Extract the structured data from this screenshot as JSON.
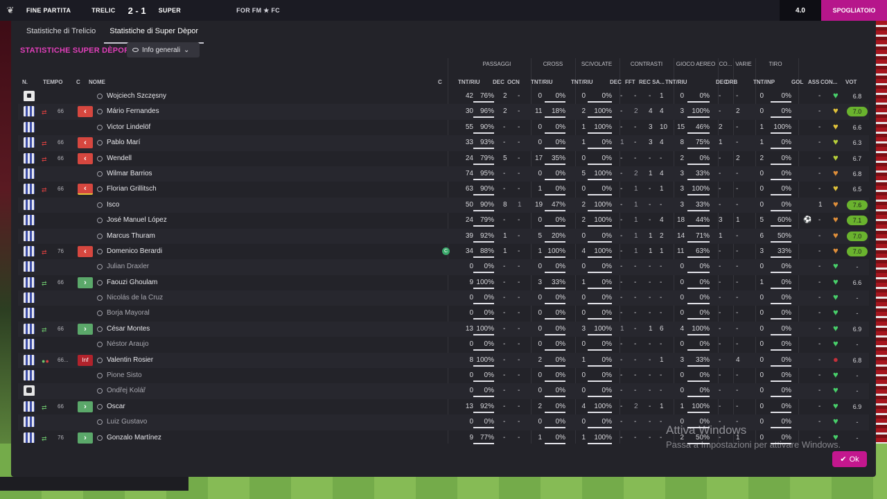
{
  "topbar": {
    "status": "FINE PARTITA",
    "home": "TRELIC",
    "score": "2 - 1",
    "away": "SUPER",
    "sponsor": "FOR FM ★ FC",
    "counter": "4.0",
    "action": "SPOGLIATOIO"
  },
  "tabs": [
    "Statistiche di Trelicio",
    "Statistiche di Super Dèpor"
  ],
  "section_title": "STATISTICHE SUPER DÈPOR",
  "view_dropdown": "Info generali",
  "groups": [
    "PASSAGGI",
    "CROSS",
    "SCIVOLATE",
    "CONTRASTI",
    "GIOCO AEREO",
    "CO...",
    "VARIE",
    "TIRO"
  ],
  "columns": [
    "N.",
    "TEMPO",
    "C",
    "NOME",
    "C",
    "TNT/RIU",
    "DEC",
    "OCN",
    "TNT/RIU",
    "TNT/RIU",
    "DEC",
    "FFT",
    "REC SA...",
    "TNT/RIU",
    "DEC",
    "DRB",
    "TNT/INP",
    "GOL",
    "ASS",
    "CON...",
    "VOT"
  ],
  "rows": [
    {
      "name": "Wojciech Szczęsny",
      "kit": "gk",
      "sub": "",
      "min": "",
      "badge": "",
      "pm": "42",
      "pp": "76%",
      "dec": "2",
      "ocn": "-",
      "cr": "0",
      "crp": "0%",
      "sc": "0",
      "scp": "0%",
      "cdec": "-",
      "fft": "-",
      "rec": "-",
      "sa": "1",
      "ga": "0",
      "gap": "0%",
      "codec": "-",
      "drb": "-",
      "ti": "0",
      "tip": "0%",
      "gol": "",
      "ass": "-",
      "con": "green",
      "vot": "6.8",
      "votHL": false
    },
    {
      "name": "Mário Fernandes",
      "kit": "field",
      "sub": "red",
      "min": "66",
      "badge": "out",
      "pm": "30",
      "pp": "96%",
      "dec": "2",
      "ocn": "-",
      "cr": "11",
      "crp": "18%",
      "sc": "2",
      "scp": "100%",
      "cdec": "-",
      "fft": "2",
      "rec": "4",
      "sa": "4",
      "ga": "3",
      "gap": "100%",
      "codec": "-",
      "drb": "2",
      "ti": "0",
      "tip": "0%",
      "gol": "",
      "ass": "-",
      "con": "yellow",
      "vot": "7.0",
      "votHL": true
    },
    {
      "name": "Victor Lindelöf",
      "kit": "field",
      "sub": "",
      "min": "",
      "badge": "",
      "pm": "55",
      "pp": "90%",
      "dec": "-",
      "ocn": "-",
      "cr": "0",
      "crp": "0%",
      "sc": "1",
      "scp": "100%",
      "cdec": "-",
      "fft": "-",
      "rec": "3",
      "sa": "10",
      "ga": "15",
      "gap": "46%",
      "codec": "2",
      "drb": "-",
      "ti": "1",
      "tip": "100%",
      "gol": "",
      "ass": "-",
      "con": "yellow",
      "vot": "6.6",
      "votHL": false
    },
    {
      "name": "Pablo Marí",
      "kit": "field",
      "sub": "red",
      "min": "66",
      "badge": "out",
      "pm": "33",
      "pp": "93%",
      "dec": "-",
      "ocn": "-",
      "cr": "0",
      "crp": "0%",
      "sc": "1",
      "scp": "0%",
      "cdec": "1",
      "fft": "-",
      "rec": "3",
      "sa": "4",
      "ga": "8",
      "gap": "75%",
      "codec": "1",
      "drb": "-",
      "ti": "1",
      "tip": "0%",
      "gol": "",
      "ass": "-",
      "con": "yellowgreen",
      "vot": "6.3",
      "votHL": false
    },
    {
      "name": "Wendell",
      "kit": "field",
      "sub": "red",
      "min": "66",
      "badge": "out",
      "pm": "24",
      "pp": "79%",
      "dec": "5",
      "ocn": "-",
      "cr": "17",
      "crp": "35%",
      "sc": "0",
      "scp": "0%",
      "cdec": "-",
      "fft": "-",
      "rec": "-",
      "sa": "-",
      "ga": "2",
      "gap": "0%",
      "codec": "-",
      "drb": "2",
      "ti": "2",
      "tip": "0%",
      "gol": "",
      "ass": "-",
      "con": "yellowgreen",
      "vot": "6.7",
      "votHL": false
    },
    {
      "name": "Wilmar Barrios",
      "kit": "field",
      "sub": "",
      "min": "",
      "badge": "",
      "pm": "74",
      "pp": "95%",
      "dec": "-",
      "ocn": "-",
      "cr": "0",
      "crp": "0%",
      "sc": "5",
      "scp": "100%",
      "cdec": "-",
      "fft": "2",
      "rec": "1",
      "sa": "4",
      "ga": "3",
      "gap": "33%",
      "codec": "-",
      "drb": "-",
      "ti": "0",
      "tip": "0%",
      "gol": "",
      "ass": "-",
      "con": "orange",
      "vot": "6.8",
      "votHL": false
    },
    {
      "name": "Florian Grillitsch",
      "kit": "field",
      "sub": "red",
      "min": "66",
      "badge": "out yl",
      "pm": "63",
      "pp": "90%",
      "dec": "-",
      "ocn": "-",
      "cr": "1",
      "crp": "0%",
      "sc": "0",
      "scp": "0%",
      "cdec": "-",
      "fft": "1",
      "rec": "-",
      "sa": "1",
      "ga": "3",
      "gap": "100%",
      "codec": "-",
      "drb": "-",
      "ti": "0",
      "tip": "0%",
      "gol": "",
      "ass": "-",
      "con": "yellow",
      "vot": "6.5",
      "votHL": false
    },
    {
      "name": "Isco",
      "kit": "field",
      "sub": "",
      "min": "",
      "badge": "",
      "pm": "50",
      "pp": "90%",
      "dec": "8",
      "ocn": "1",
      "cr": "19",
      "crp": "47%",
      "sc": "2",
      "scp": "100%",
      "cdec": "-",
      "fft": "1",
      "rec": "-",
      "sa": "-",
      "ga": "3",
      "gap": "33%",
      "codec": "-",
      "drb": "-",
      "ti": "0",
      "tip": "0%",
      "gol": "",
      "ass": "1",
      "con": "orange",
      "vot": "7.6",
      "votHL": true
    },
    {
      "name": "José Manuel López",
      "kit": "field",
      "sub": "",
      "min": "",
      "badge": "",
      "pm": "24",
      "pp": "79%",
      "dec": "-",
      "ocn": "-",
      "cr": "0",
      "crp": "0%",
      "sc": "2",
      "scp": "100%",
      "cdec": "-",
      "fft": "1",
      "rec": "-",
      "sa": "4",
      "ga": "18",
      "gap": "44%",
      "codec": "3",
      "drb": "1",
      "ti": "5",
      "tip": "60%",
      "gol": "⚽",
      "ass": "-",
      "con": "orange",
      "vot": "7.1",
      "votHL": true
    },
    {
      "name": "Marcus Thuram",
      "kit": "field",
      "sub": "",
      "min": "",
      "badge": "",
      "pm": "39",
      "pp": "92%",
      "dec": "1",
      "ocn": "-",
      "cr": "5",
      "crp": "20%",
      "sc": "0",
      "scp": "0%",
      "cdec": "-",
      "fft": "1",
      "rec": "1",
      "sa": "2",
      "ga": "14",
      "gap": "71%",
      "codec": "1",
      "drb": "-",
      "ti": "6",
      "tip": "50%",
      "gol": "",
      "ass": "-",
      "con": "orange",
      "vot": "7.0",
      "votHL": true
    },
    {
      "name": "Domenico Berardi",
      "kit": "field",
      "sub": "red",
      "min": "76",
      "badge": "out",
      "pm": "34",
      "pp": "88%",
      "dec": "1",
      "ocn": "-",
      "cr": "1",
      "crp": "100%",
      "sc": "4",
      "scp": "100%",
      "cdec": "-",
      "fft": "1",
      "rec": "1",
      "sa": "1",
      "ga": "11",
      "gap": "63%",
      "codec": "-",
      "drb": "-",
      "ti": "3",
      "tip": "33%",
      "gol": "",
      "ass": "-",
      "con": "orange",
      "vot": "7.0",
      "votHL": true,
      "cap": "C"
    },
    {
      "name": "Julian Draxler",
      "kit": "field",
      "sub": "",
      "min": "",
      "badge": "",
      "pm": "0",
      "pp": "0%",
      "dec": "-",
      "ocn": "-",
      "cr": "0",
      "crp": "0%",
      "sc": "0",
      "scp": "0%",
      "cdec": "-",
      "fft": "-",
      "rec": "-",
      "sa": "-",
      "ga": "0",
      "gap": "0%",
      "codec": "-",
      "drb": "-",
      "ti": "0",
      "tip": "0%",
      "gol": "",
      "ass": "-",
      "con": "green",
      "vot": "-",
      "votHL": false,
      "dim": true
    },
    {
      "name": "Faouzi Ghoulam",
      "kit": "field",
      "sub": "grn",
      "min": "66",
      "badge": "in",
      "pm": "9",
      "pp": "100%",
      "dec": "-",
      "ocn": "-",
      "cr": "3",
      "crp": "33%",
      "sc": "1",
      "scp": "0%",
      "cdec": "-",
      "fft": "-",
      "rec": "-",
      "sa": "-",
      "ga": "0",
      "gap": "0%",
      "codec": "-",
      "drb": "-",
      "ti": "1",
      "tip": "0%",
      "gol": "",
      "ass": "-",
      "con": "green",
      "vot": "6.6",
      "votHL": false
    },
    {
      "name": "Nicolás de la Cruz",
      "kit": "field",
      "sub": "",
      "min": "",
      "badge": "",
      "pm": "0",
      "pp": "0%",
      "dec": "-",
      "ocn": "-",
      "cr": "0",
      "crp": "0%",
      "sc": "0",
      "scp": "0%",
      "cdec": "-",
      "fft": "-",
      "rec": "-",
      "sa": "-",
      "ga": "0",
      "gap": "0%",
      "codec": "-",
      "drb": "-",
      "ti": "0",
      "tip": "0%",
      "gol": "",
      "ass": "-",
      "con": "green",
      "vot": "-",
      "votHL": false,
      "dim": true
    },
    {
      "name": "Borja Mayoral",
      "kit": "field",
      "sub": "",
      "min": "",
      "badge": "",
      "pm": "0",
      "pp": "0%",
      "dec": "-",
      "ocn": "-",
      "cr": "0",
      "crp": "0%",
      "sc": "0",
      "scp": "0%",
      "cdec": "-",
      "fft": "-",
      "rec": "-",
      "sa": "-",
      "ga": "0",
      "gap": "0%",
      "codec": "-",
      "drb": "-",
      "ti": "0",
      "tip": "0%",
      "gol": "",
      "ass": "-",
      "con": "green",
      "vot": "-",
      "votHL": false,
      "dim": true
    },
    {
      "name": "César Montes",
      "kit": "field",
      "sub": "grn",
      "min": "66",
      "badge": "in",
      "pm": "13",
      "pp": "100%",
      "dec": "-",
      "ocn": "-",
      "cr": "0",
      "crp": "0%",
      "sc": "3",
      "scp": "100%",
      "cdec": "1",
      "fft": "-",
      "rec": "1",
      "sa": "6",
      "ga": "4",
      "gap": "100%",
      "codec": "-",
      "drb": "-",
      "ti": "0",
      "tip": "0%",
      "gol": "",
      "ass": "-",
      "con": "green",
      "vot": "6.9",
      "votHL": false
    },
    {
      "name": "Néstor Araujo",
      "kit": "field",
      "sub": "",
      "min": "",
      "badge": "",
      "pm": "0",
      "pp": "0%",
      "dec": "-",
      "ocn": "-",
      "cr": "0",
      "crp": "0%",
      "sc": "0",
      "scp": "0%",
      "cdec": "-",
      "fft": "-",
      "rec": "-",
      "sa": "-",
      "ga": "0",
      "gap": "0%",
      "codec": "-",
      "drb": "-",
      "ti": "0",
      "tip": "0%",
      "gol": "",
      "ass": "-",
      "con": "green",
      "vot": "-",
      "votHL": false,
      "dim": true
    },
    {
      "name": "Valentin Rosier",
      "kit": "field",
      "sub": "mix",
      "min": "66...",
      "badge": "inf",
      "pm": "8",
      "pp": "100%",
      "dec": "-",
      "ocn": "-",
      "cr": "2",
      "crp": "0%",
      "sc": "1",
      "scp": "0%",
      "cdec": "-",
      "fft": "-",
      "rec": "-",
      "sa": "1",
      "ga": "3",
      "gap": "33%",
      "codec": "-",
      "drb": "4",
      "ti": "0",
      "tip": "0%",
      "gol": "",
      "ass": "-",
      "con": "red",
      "vot": "6.8",
      "votHL": false
    },
    {
      "name": "Pione Sisto",
      "kit": "field",
      "sub": "",
      "min": "",
      "badge": "",
      "pm": "0",
      "pp": "0%",
      "dec": "-",
      "ocn": "-",
      "cr": "0",
      "crp": "0%",
      "sc": "0",
      "scp": "0%",
      "cdec": "-",
      "fft": "-",
      "rec": "-",
      "sa": "-",
      "ga": "0",
      "gap": "0%",
      "codec": "-",
      "drb": "-",
      "ti": "0",
      "tip": "0%",
      "gol": "",
      "ass": "-",
      "con": "green",
      "vot": "-",
      "votHL": false,
      "dim": true
    },
    {
      "name": "Ondřej Kolář",
      "kit": "gkd",
      "sub": "",
      "min": "",
      "badge": "",
      "pm": "0",
      "pp": "0%",
      "dec": "-",
      "ocn": "-",
      "cr": "0",
      "crp": "0%",
      "sc": "0",
      "scp": "0%",
      "cdec": "-",
      "fft": "-",
      "rec": "-",
      "sa": "-",
      "ga": "0",
      "gap": "0%",
      "codec": "-",
      "drb": "-",
      "ti": "0",
      "tip": "0%",
      "gol": "",
      "ass": "-",
      "con": "green",
      "vot": "-",
      "votHL": false,
      "dim": true
    },
    {
      "name": "Oscar",
      "kit": "field",
      "sub": "grn",
      "min": "66",
      "badge": "in",
      "pm": "13",
      "pp": "92%",
      "dec": "-",
      "ocn": "-",
      "cr": "2",
      "crp": "0%",
      "sc": "4",
      "scp": "100%",
      "cdec": "-",
      "fft": "2",
      "rec": "-",
      "sa": "1",
      "ga": "1",
      "gap": "100%",
      "codec": "-",
      "drb": "-",
      "ti": "0",
      "tip": "0%",
      "gol": "",
      "ass": "-",
      "con": "green",
      "vot": "6.9",
      "votHL": false
    },
    {
      "name": "Luiz Gustavo",
      "kit": "field",
      "sub": "",
      "min": "",
      "badge": "",
      "pm": "0",
      "pp": "0%",
      "dec": "-",
      "ocn": "-",
      "cr": "0",
      "crp": "0%",
      "sc": "0",
      "scp": "0%",
      "cdec": "-",
      "fft": "-",
      "rec": "-",
      "sa": "-",
      "ga": "0",
      "gap": "0%",
      "codec": "-",
      "drb": "-",
      "ti": "0",
      "tip": "0%",
      "gol": "",
      "ass": "-",
      "con": "green",
      "vot": "-",
      "votHL": false,
      "dim": true
    },
    {
      "name": "Gonzalo Martínez",
      "kit": "field",
      "sub": "grn",
      "min": "76",
      "badge": "in",
      "pm": "9",
      "pp": "77%",
      "dec": "-",
      "ocn": "-",
      "cr": "1",
      "crp": "0%",
      "sc": "1",
      "scp": "100%",
      "cdec": "-",
      "fft": "-",
      "rec": "-",
      "sa": "-",
      "ga": "2",
      "gap": "50%",
      "codec": "-",
      "drb": "1",
      "ti": "0",
      "tip": "0%",
      "gol": "",
      "ass": "-",
      "con": "green",
      "vot": "-",
      "votHL": false
    }
  ],
  "ok_label": "Ok",
  "watermark": {
    "title": "Attiva Windows",
    "subtitle": "Passa a Impostazioni per attivare Windows."
  },
  "colors": {
    "accent": "#e13fb9",
    "ok_button": "#c4178e",
    "sub_out": "#d6473f",
    "sub_in": "#5ba86a",
    "vote_highlight": "#6ab32e"
  }
}
